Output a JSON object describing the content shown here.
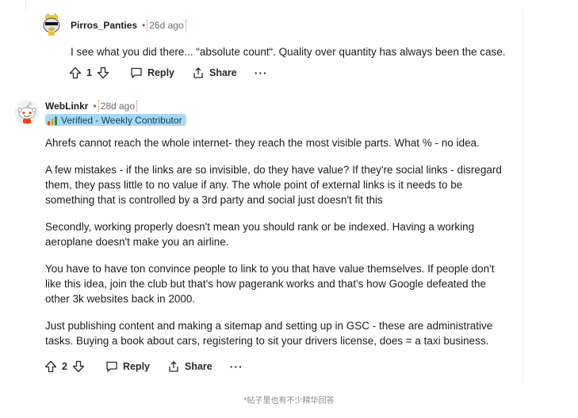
{
  "comments": [
    {
      "author": "Pirros_Panties",
      "time": "26d ago",
      "body": [
        "I see what you did there... “absolute count“. Quality over quantity has always been the case."
      ],
      "score": "1",
      "reply_label": "Reply",
      "share_label": "Share",
      "more_label": "···"
    },
    {
      "author": "WebLinkr",
      "time": "28d ago",
      "flair": "Verified - Weekly Contributor",
      "body": [
        "Ahrefs cannot reach the whole internet- they reach the most visible parts. What % - no idea.",
        "A few mistakes - if the links are so invisible, do they have value? If they're social links - disregard them, they pass little to no value if any. The whole point of external links is it needs to be something that is controlled by a 3rd party and social just doesn't fit this",
        "Secondly, working properly doesn't mean you should rank or be indexed. Having a working aeroplane doesn't make you an airline.",
        "You have to have ton convince people to link to you that have value themselves. If people don't like this idea, join the club but that's how pagerank works and that's how Google defeated the other 3k websites back in 2000.",
        "Just publishing content and making a sitemap and setting up in GSC - these are administrative tasks. Buying a book about cars, registering to sit your drivers license, does = a taxi business."
      ],
      "score": "2",
      "reply_label": "Reply",
      "share_label": "Share",
      "more_label": "···"
    }
  ],
  "footer_note": "*帖子里也有不少精华回答",
  "colors": {
    "flair_bg": "#a7d8f2",
    "flair_text": "#1a3f63",
    "time_border": "#e06a5c"
  },
  "icons": [
    "upvote-icon",
    "downvote-icon",
    "comment-icon",
    "share-icon",
    "snoo-avatar-icon",
    "verified-badge-icon"
  ]
}
